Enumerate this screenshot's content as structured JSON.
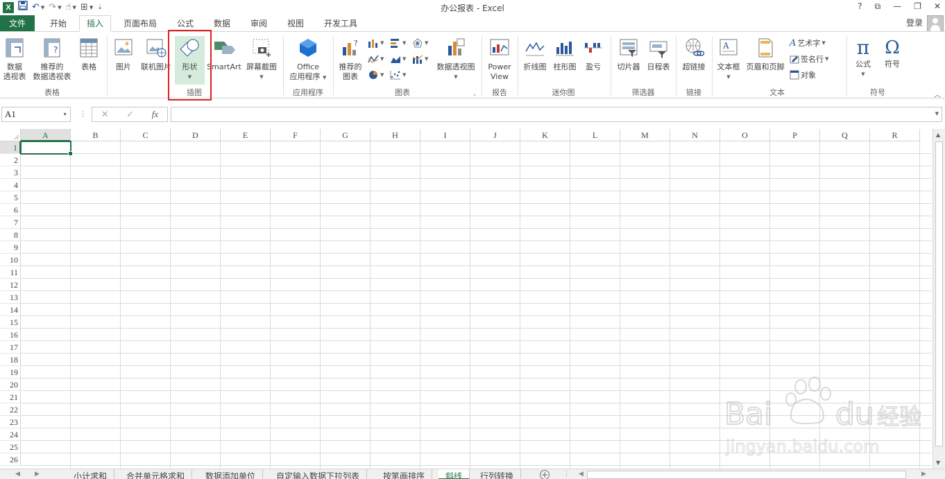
{
  "app": {
    "title": "办公报表 - Excel",
    "help": "?",
    "accent": "#217346"
  },
  "tabs": {
    "file": "文件",
    "items": [
      "开始",
      "插入",
      "页面布局",
      "公式",
      "数据",
      "审阅",
      "视图",
      "开发工具"
    ],
    "active": "插入",
    "login": "登录"
  },
  "ribbon": {
    "groups": {
      "tables": "表格",
      "illustrations": "插图",
      "apps": "应用程序",
      "charts": "图表",
      "reports": "报告",
      "sparklines": "迷你图",
      "filters": "筛选器",
      "links": "链接",
      "text": "文本",
      "symbols": "符号"
    },
    "buttons": {
      "pivot_l1": "数据",
      "pivot_l2": "透视表",
      "rec_pivot_l1": "推荐的",
      "rec_pivot_l2": "数据透视表",
      "table": "表格",
      "picture": "图片",
      "online_picture": "联机图片",
      "shapes": "形状",
      "smartart": "SmartArt",
      "screenshot": "屏幕截图",
      "office_apps_l1": "Office",
      "office_apps_l2": "应用程序",
      "rec_charts_l1": "推荐的",
      "rec_charts_l2": "图表",
      "pivot_chart": "数据透视图",
      "power_view_l1": "Power",
      "power_view_l2": "View",
      "line": "折线图",
      "column": "柱形图",
      "winloss": "盈亏",
      "slicer": "切片器",
      "timeline": "日程表",
      "hyperlink": "超链接",
      "textbox": "文本框",
      "header_footer": "页眉和页脚",
      "wordart": "艺术字",
      "signature": "签名行",
      "object": "对象",
      "equation": "公式",
      "symbol": "符号"
    }
  },
  "formula_bar": {
    "name_box": "A1",
    "fx": "fx",
    "value": ""
  },
  "grid": {
    "columns": [
      "A",
      "B",
      "C",
      "D",
      "E",
      "F",
      "G",
      "H",
      "I",
      "J",
      "K",
      "L",
      "M",
      "N",
      "O",
      "P",
      "Q",
      "R"
    ],
    "rows": [
      "1",
      "2",
      "3",
      "4",
      "5",
      "6",
      "7",
      "8",
      "9",
      "10",
      "11",
      "12",
      "13",
      "14",
      "15",
      "16",
      "17",
      "18",
      "19",
      "20",
      "21",
      "22",
      "23",
      "24",
      "25",
      "26"
    ],
    "selected_cell": "A1"
  },
  "sheets": {
    "items": [
      "小计求和",
      "合并单元格求和",
      "数据添加单位",
      "自定输入数据下拉列表",
      "按笔画排序",
      "斜线",
      "行列转换"
    ],
    "active": "斜线"
  },
  "watermark": {
    "brand": "Bai du 经验",
    "url": "jingyan.baidu.com"
  }
}
